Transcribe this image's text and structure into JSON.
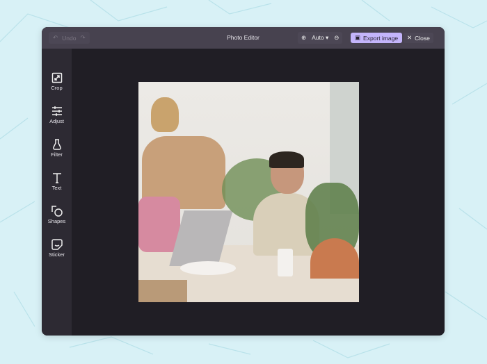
{
  "topbar": {
    "undo": "Undo",
    "title": "Photo Editor",
    "zoom_value": "Auto",
    "export": "Export image",
    "close": "Close"
  },
  "tools": [
    {
      "label": "Crop"
    },
    {
      "label": "Adjust"
    },
    {
      "label": "Filter"
    },
    {
      "label": "Text"
    },
    {
      "label": "Shapes"
    },
    {
      "label": "Sticker"
    }
  ],
  "colors": {
    "accent": "#c4b5fb",
    "background": "#d8f1f6"
  }
}
